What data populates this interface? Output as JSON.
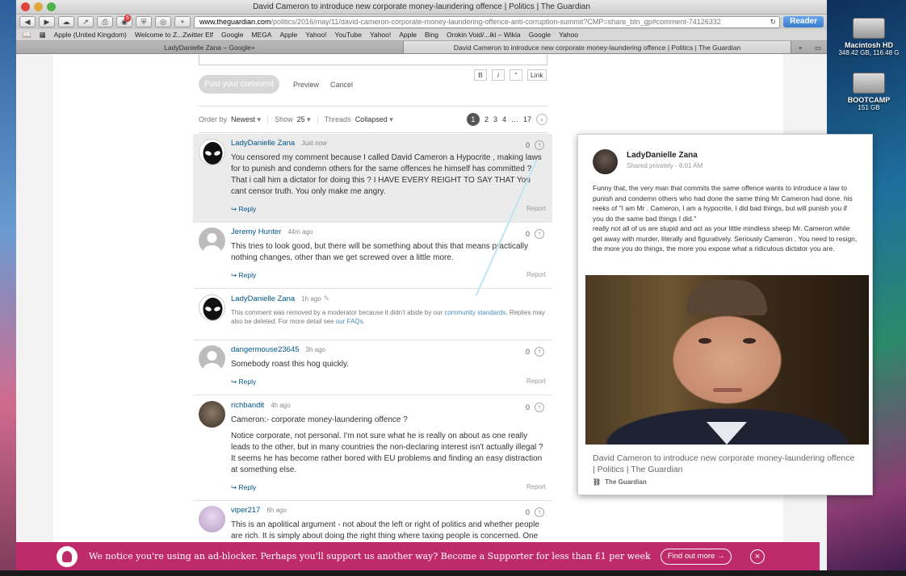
{
  "window": {
    "title": "David Cameron to introduce new corporate money-laundering offence | Politics | The Guardian",
    "url_domain": "www.theguardian.com",
    "url_path": "/politics/2016/may/11/david-cameron-corporate-money-laundering-offence-anti-corruption-summit?CMP=share_btn_gp#comment-74126332",
    "reader_label": "Reader",
    "badge_count": "6"
  },
  "bookmarks": [
    "Apple (United Kingdom)",
    "Welcome to Z...Zwitter Elf",
    "Google",
    "MEGA",
    "Apple",
    "Yahoo!",
    "YouTube",
    "Yahoo!",
    "Apple",
    "Bing",
    "Orokin Void/...iki – Wikia",
    "Google",
    "Yahoo"
  ],
  "tabs": [
    "LadyDanielle Zana – Google+",
    "David Cameron to introduce new corporate money-laundering offence | Politics | The Guardian"
  ],
  "desktop": {
    "disk1_name": "Macintosh HD",
    "disk1_size": "348.42 GB, 116.48 G",
    "disk2_name": "BOOTCAMP",
    "disk2_size": "151 GB"
  },
  "composer": {
    "post_label": "Post your comment",
    "preview_label": "Preview",
    "cancel_label": "Cancel",
    "bold": "B",
    "italic": "i",
    "quote": "\"",
    "link": "Link"
  },
  "controls": {
    "order_label": "Order by",
    "order_value": "Newest",
    "show_label": "Show",
    "show_value": "25",
    "threads_label": "Threads",
    "threads_value": "Collapsed",
    "pages": [
      "1",
      "2",
      "3",
      "4",
      "…",
      "17"
    ],
    "current_page": "1"
  },
  "comments": [
    {
      "name": "LadyDanielle Zana",
      "time": "Just now",
      "votes": "0",
      "text": "You censored my comment because I called David Cameron a Hypocrite , making laws for to punish and condemn others for the same offences he himself has committed ? That i call him a dictator for doing this ? I HAVE EVERY REIGHT TO SAY THAT You cant censor truth. You only make me angry."
    },
    {
      "name": "Jeremy Hunter",
      "time": "44m ago",
      "votes": "0",
      "text": "This tries to look good, but there will be something about this that means practically nothing changes, other than we get screwed over a little more."
    },
    {
      "name": "LadyDanielle Zana",
      "time": "1h ago",
      "removed_a": "This comment was removed by a moderator because it didn't abide by our ",
      "removed_link1": "community standards",
      "removed_b": ". Replies may also be deleted. For more detail see ",
      "removed_link2": "our FAQs",
      "removed_c": "."
    },
    {
      "name": "dangermouse23645",
      "time": "3h ago",
      "votes": "0",
      "text": "Somebody roast this hog quickly."
    },
    {
      "name": "richbandit",
      "time": "4h ago",
      "votes": "0",
      "text": "Cameron:- corporate money-laundering offence ?",
      "text2": "Notice corporate, not personal. I'm not sure what he is really on about as one really leads to the other, but in many countries the non-declaring interest isn't actually illegal ? It seems he has become rather bored with EU problems and finding an easy distraction at something else."
    },
    {
      "name": "viper217",
      "time": "6h ago",
      "votes": "0",
      "text": "This is an apolitical argument - not about the left or right of politics and whether people are rich. It is simply about doing the right thing where taxing people is concerned. One of"
    }
  ],
  "reply_label": "Reply",
  "report_label": "Report",
  "card": {
    "name": "LadyDanielle Zana",
    "sub": "Shared privately  -  6:01 AM",
    "text": "Funny that, the very man that commits the same offence wants to introduce a law to punish and condemn others who had done the same thing Mr Cameron had done. his reeks of \"I am Mr . Cameron, I am a hypocrite, I did bad things, but will punish you if you do the same bad things I did.\"\nreally not all of us are stupid and act as your little mindless sheep Mr. Cameron while get away with murder, literally and figuratively. Seriously Cameron , You need to resign, the more you do things, the more you expose what a ridiculous dictator you are.",
    "link_title": "David Cameron to introduce new corporate money-laundering offence | Politics | The Guardian",
    "source": "The Guardian"
  },
  "banner": {
    "text": "We notice you're using an ad-blocker. Perhaps you'll support us another way? Become a Supporter for less than £1 per week",
    "button": "Find out more"
  }
}
